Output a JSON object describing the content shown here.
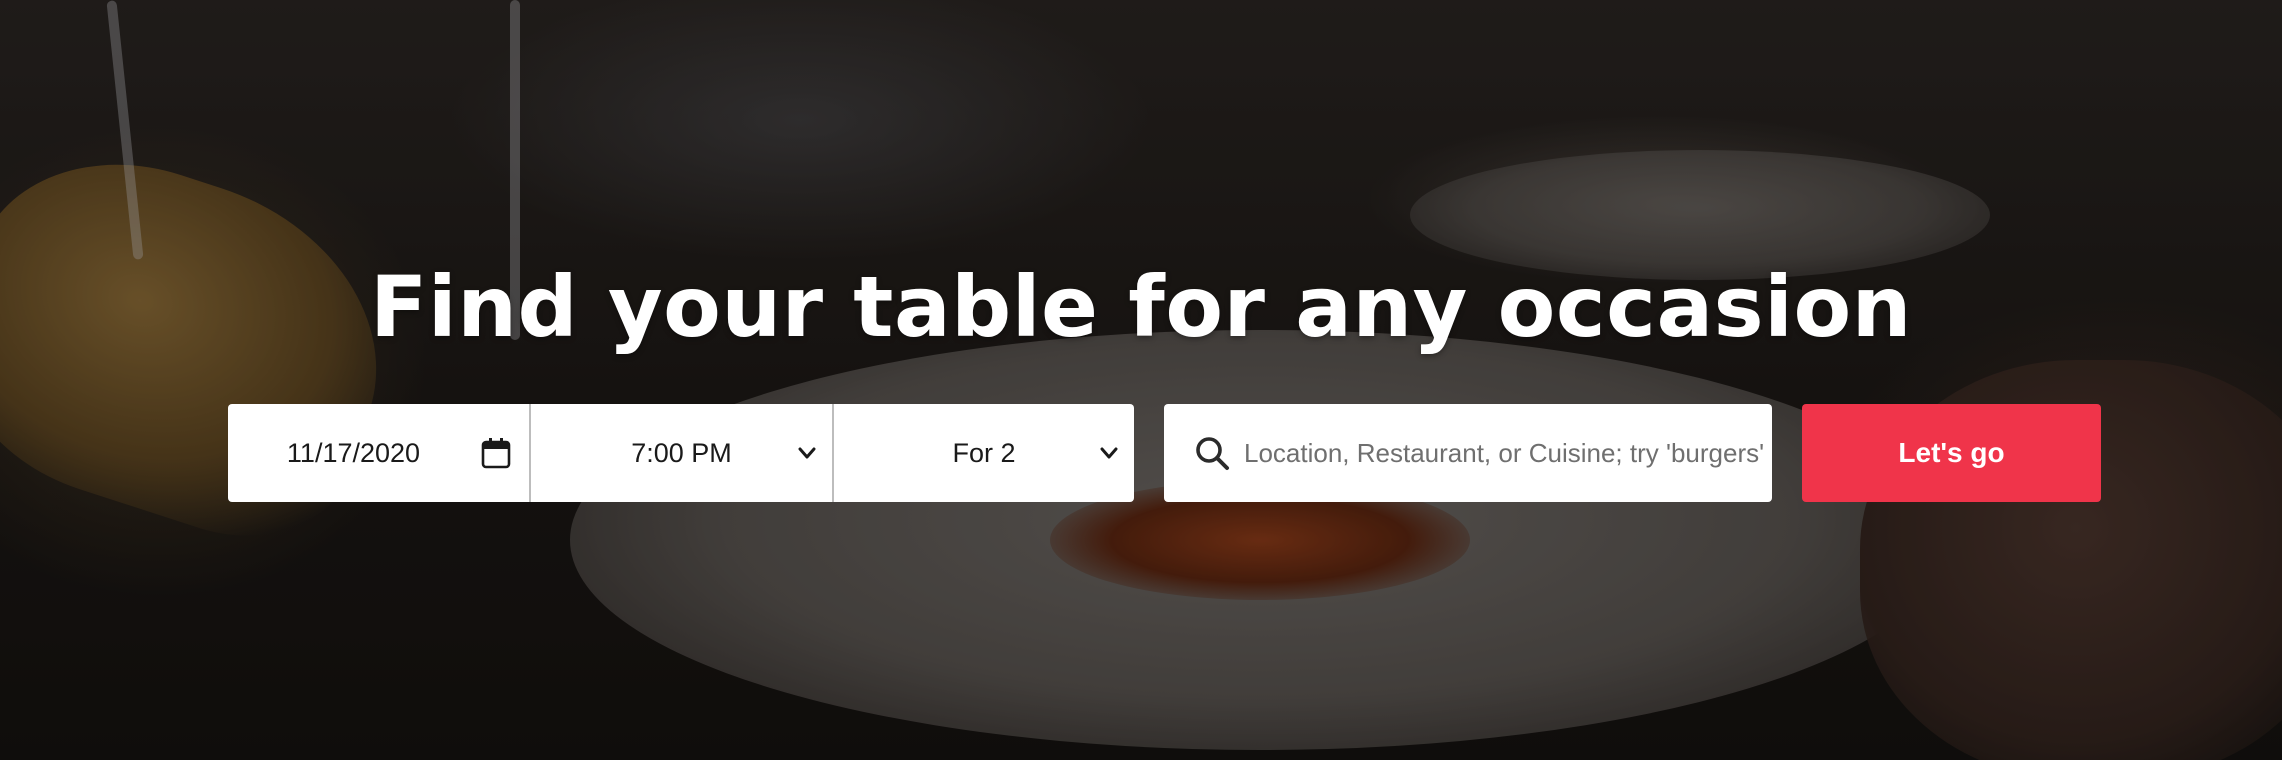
{
  "hero": {
    "headline": "Find your table for any occasion"
  },
  "search_form": {
    "date_value": "11/17/2020",
    "time_value": "7:00 PM",
    "party_size_value": "For 2",
    "search_placeholder": "Location, Restaurant, or Cuisine; try 'burgers'",
    "search_value": "",
    "submit_label": "Let's go"
  },
  "icons": {
    "date": "calendar-icon",
    "time": "chevron-down-icon",
    "party": "chevron-down-icon",
    "search": "search-icon"
  },
  "colors": {
    "accent": "#f0344a",
    "headline": "#ffffff",
    "field_background": "#ffffff"
  }
}
